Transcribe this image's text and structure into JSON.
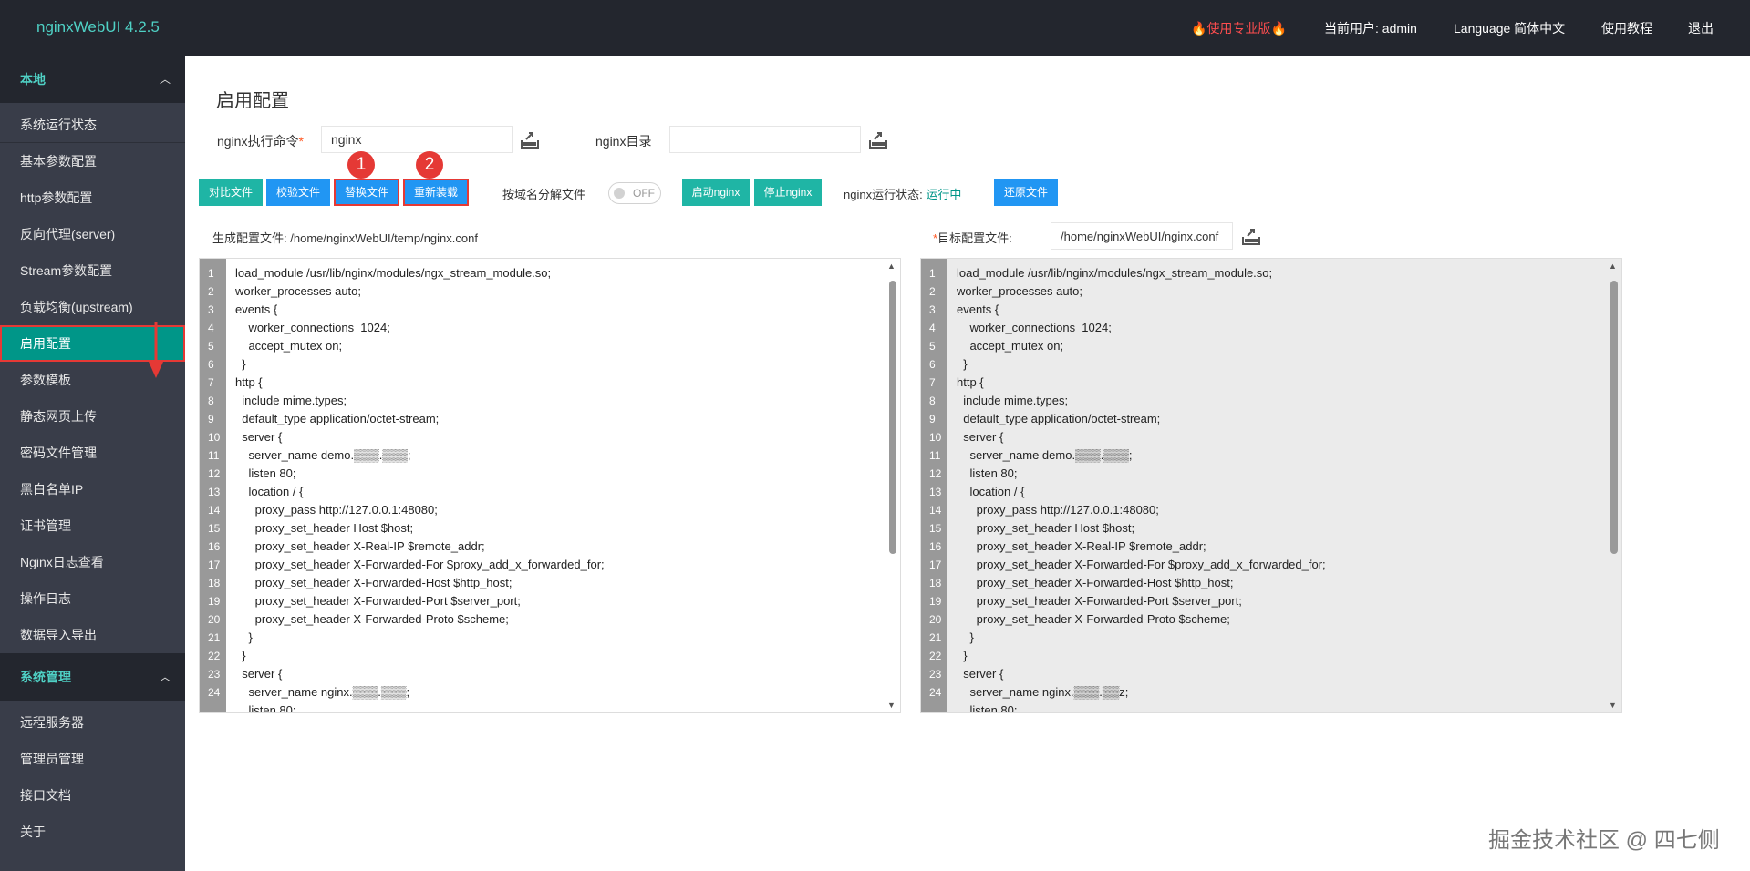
{
  "header": {
    "logo": "nginxWebUI 4.2.5",
    "pro_label": "使用专业版",
    "current_user": "当前用户: admin",
    "language": "Language 简体中文",
    "tutorial": "使用教程",
    "logout": "退出"
  },
  "sidebar": {
    "group_local": "本地",
    "items_local": [
      "系统运行状态",
      "基本参数配置",
      "http参数配置",
      "反向代理(server)",
      "Stream参数配置",
      "负载均衡(upstream)",
      "启用配置",
      "参数模板",
      "静态网页上传",
      "密码文件管理",
      "黑白名单IP",
      "证书管理",
      "Nginx日志查看",
      "操作日志",
      "数据导入导出"
    ],
    "active_index": 6,
    "group_system": "系统管理",
    "items_system": [
      "远程服务器",
      "管理员管理",
      "接口文档",
      "关于"
    ]
  },
  "main": {
    "title": "启用配置",
    "nginx_cmd_label": "nginx执行命令",
    "nginx_cmd_value": "nginx",
    "nginx_dir_label": "nginx目录",
    "nginx_dir_value": "",
    "buttons": {
      "compare": "对比文件",
      "verify": "校验文件",
      "replace": "替换文件",
      "reload": "重新装载",
      "start": "启动nginx",
      "stop": "停止nginx",
      "restore": "还原文件"
    },
    "badges": [
      "1",
      "2"
    ],
    "split_by_domain_label": "按域名分解文件",
    "switch_text": "OFF",
    "status_label": "nginx运行状态:",
    "status_value": "运行中",
    "generated_label": "生成配置文件:",
    "generated_path": "/home/nginxWebUI/temp/nginx.conf",
    "target_label": "目标配置文件:",
    "target_path": "/home/nginxWebUI/nginx.conf"
  },
  "editor_left": [
    {
      "no": "1",
      "code": "load_module /usr/lib/nginx/modules/ngx_stream_module.so;"
    },
    {
      "no": "2",
      "code": "worker_processes auto;"
    },
    {
      "no": "3",
      "code": "events {"
    },
    {
      "no": "4",
      "code": "    worker_connections  1024;"
    },
    {
      "no": "5",
      "code": "    accept_mutex on;"
    },
    {
      "no": "6",
      "code": "  }"
    },
    {
      "no": "7",
      "code": "http {"
    },
    {
      "no": "8",
      "code": "  include mime.types;"
    },
    {
      "no": "9",
      "code": "  default_type application/octet-stream;"
    },
    {
      "no": "10",
      "code": "  server {"
    },
    {
      "no": "11",
      "code": "    server_name demo.▒▒▒.▒▒▒;"
    },
    {
      "no": "12",
      "code": "    listen 80;"
    },
    {
      "no": "13",
      "code": "    location / {"
    },
    {
      "no": "14",
      "code": "      proxy_pass http://127.0.0.1:48080;"
    },
    {
      "no": "15",
      "code": "      proxy_set_header Host $host;"
    },
    {
      "no": "16",
      "code": "      proxy_set_header X-Real-IP $remote_addr;"
    },
    {
      "no": "17",
      "code": "      proxy_set_header X-Forwarded-For $proxy_add_x_forwarded_for;"
    },
    {
      "no": "18",
      "code": "      proxy_set_header X-Forwarded-Host $http_host;"
    },
    {
      "no": "19",
      "code": "      proxy_set_header X-Forwarded-Port $server_port;"
    },
    {
      "no": "20",
      "code": "      proxy_set_header X-Forwarded-Proto $scheme;"
    },
    {
      "no": "21",
      "code": "    }"
    },
    {
      "no": "22",
      "code": "  }"
    },
    {
      "no": "23",
      "code": "  server {"
    },
    {
      "no": "24",
      "code": "    server_name nginx.▒▒▒.▒▒▒;"
    },
    {
      "no": "",
      "code": "    listen 80;"
    }
  ],
  "editor_right": [
    {
      "no": "1",
      "code": "load_module /usr/lib/nginx/modules/ngx_stream_module.so;"
    },
    {
      "no": "2",
      "code": "worker_processes auto;"
    },
    {
      "no": "3",
      "code": "events {"
    },
    {
      "no": "4",
      "code": "    worker_connections  1024;"
    },
    {
      "no": "5",
      "code": "    accept_mutex on;"
    },
    {
      "no": "6",
      "code": "  }"
    },
    {
      "no": "7",
      "code": "http {"
    },
    {
      "no": "8",
      "code": "  include mime.types;"
    },
    {
      "no": "9",
      "code": "  default_type application/octet-stream;"
    },
    {
      "no": "10",
      "code": "  server {"
    },
    {
      "no": "11",
      "code": "    server_name demo.▒▒▒.▒▒▒;"
    },
    {
      "no": "12",
      "code": "    listen 80;"
    },
    {
      "no": "13",
      "code": "    location / {"
    },
    {
      "no": "14",
      "code": "      proxy_pass http://127.0.0.1:48080;"
    },
    {
      "no": "15",
      "code": "      proxy_set_header Host $host;"
    },
    {
      "no": "16",
      "code": "      proxy_set_header X-Real-IP $remote_addr;"
    },
    {
      "no": "17",
      "code": "      proxy_set_header X-Forwarded-For $proxy_add_x_forwarded_for;"
    },
    {
      "no": "18",
      "code": "      proxy_set_header X-Forwarded-Host $http_host;"
    },
    {
      "no": "19",
      "code": "      proxy_set_header X-Forwarded-Port $server_port;"
    },
    {
      "no": "20",
      "code": "      proxy_set_header X-Forwarded-Proto $scheme;"
    },
    {
      "no": "21",
      "code": "    }"
    },
    {
      "no": "22",
      "code": "  }"
    },
    {
      "no": "23",
      "code": "  server {"
    },
    {
      "no": "24",
      "code": "    server_name nginx.▒▒▒.▒▒z;"
    },
    {
      "no": "",
      "code": "    listen 80;"
    }
  ],
  "watermark": "掘金技术社区 @ 四七侧",
  "icons": {
    "upload": "upload-icon",
    "flame": "flame-icon",
    "chevron": "chevron-up-icon",
    "arrow": "red-down-arrow-icon"
  },
  "colors": {
    "header_bg": "#23262e",
    "sidebar_bg": "#393d49",
    "accent": "#009688",
    "highlight": "#e53935",
    "button_blue": "#2196f3"
  }
}
